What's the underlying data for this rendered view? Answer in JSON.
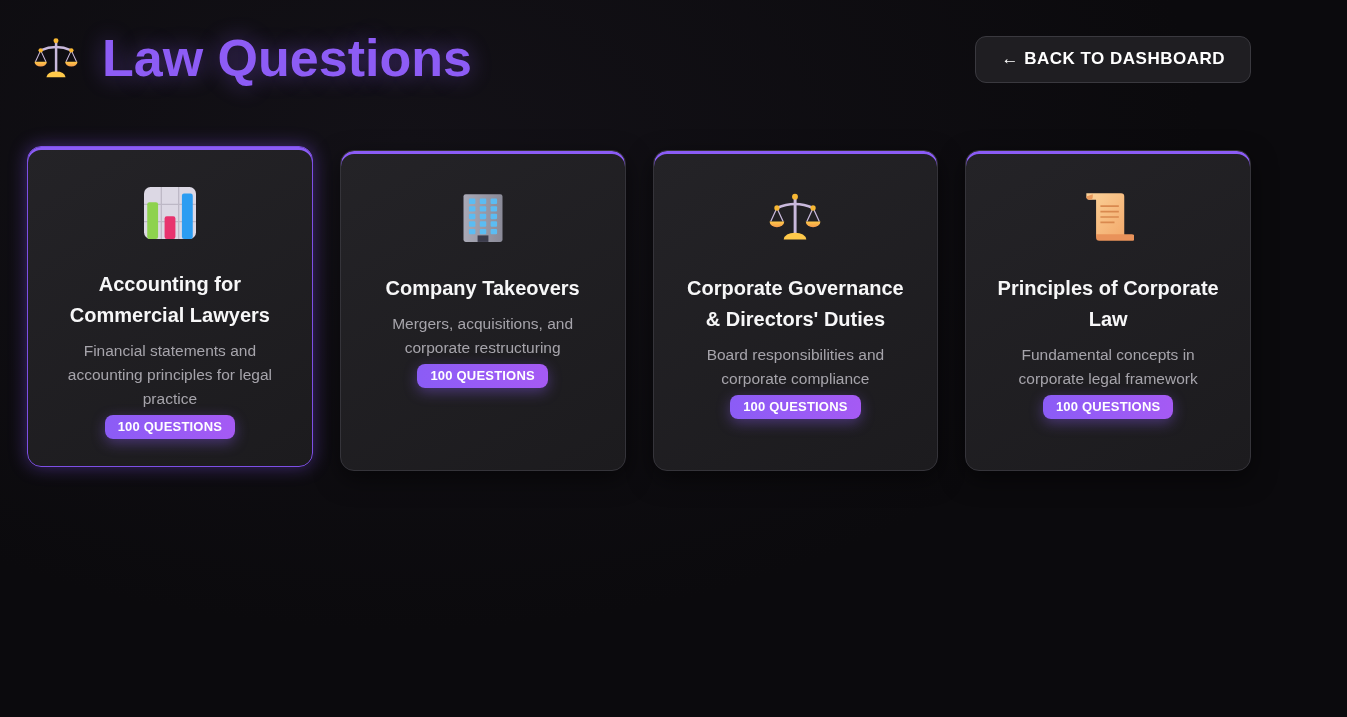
{
  "header": {
    "title": "Law Questions",
    "back_button": "← BACK TO DASHBOARD"
  },
  "cards": [
    {
      "title": "Accounting for Commercial Lawyers",
      "description": "Financial statements and accounting principles for legal practice",
      "badge": "100 QUESTIONS",
      "selected": true
    },
    {
      "title": "Company Takeovers",
      "description": "Mergers, acquisitions, and corporate restructuring",
      "badge": "100 QUESTIONS",
      "selected": false
    },
    {
      "title": "Corporate Governance & Directors' Duties",
      "description": "Board responsibilities and corporate compliance",
      "badge": "100 QUESTIONS",
      "selected": false
    },
    {
      "title": "Principles of Corporate Law",
      "description": "Fundamental concepts in corporate legal framework",
      "badge": "100 QUESTIONS",
      "selected": false
    }
  ]
}
